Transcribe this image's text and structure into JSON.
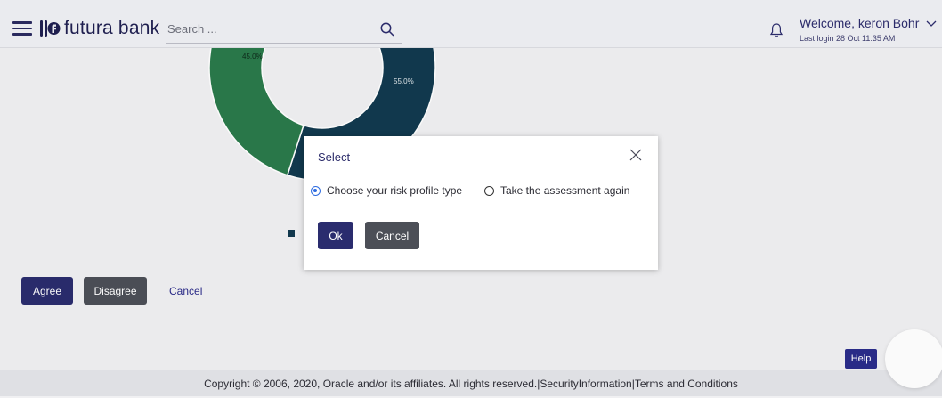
{
  "header": {
    "brand_name": "futura bank",
    "search_placeholder": "Search ...",
    "welcome_text": "Welcome, keron Bohr",
    "last_login": "Last login 28 Oct 11:35 AM",
    "icons": {
      "menu": "hamburger-menu-icon",
      "logo": "futura-bank-logo-icon",
      "search": "search-icon",
      "notifications": "bell-icon",
      "user_menu": "chevron-down-icon"
    }
  },
  "chart_data": {
    "type": "pie",
    "style": "donut",
    "slices": [
      {
        "label": "45.0%",
        "value": 45.0,
        "color": "#2a7a4b"
      },
      {
        "label": "55.0%",
        "value": 55.0,
        "color": "#123a4f"
      }
    ]
  },
  "actions": {
    "agree_label": "Agree",
    "disagree_label": "Disagree",
    "cancel_label": "Cancel"
  },
  "modal": {
    "title": "Select",
    "options": [
      {
        "label": "Choose your risk profile type",
        "selected": true
      },
      {
        "label": "Take the assessment again",
        "selected": false
      }
    ],
    "ok_label": "Ok",
    "cancel_label": "Cancel",
    "close_icon": "close-icon"
  },
  "footer": {
    "copyright": "Copyright © 2006, 2020, Oracle and/or its affiliates. All rights reserved.|SecurityInformation|Terms and Conditions",
    "help_label": "Help"
  },
  "colors": {
    "primary": "#2a2c6e",
    "secondary": "#4c4f57",
    "background": "#f0f0f2",
    "modal_bg": "#ffffff",
    "radio_selected": "#2d6be0"
  }
}
